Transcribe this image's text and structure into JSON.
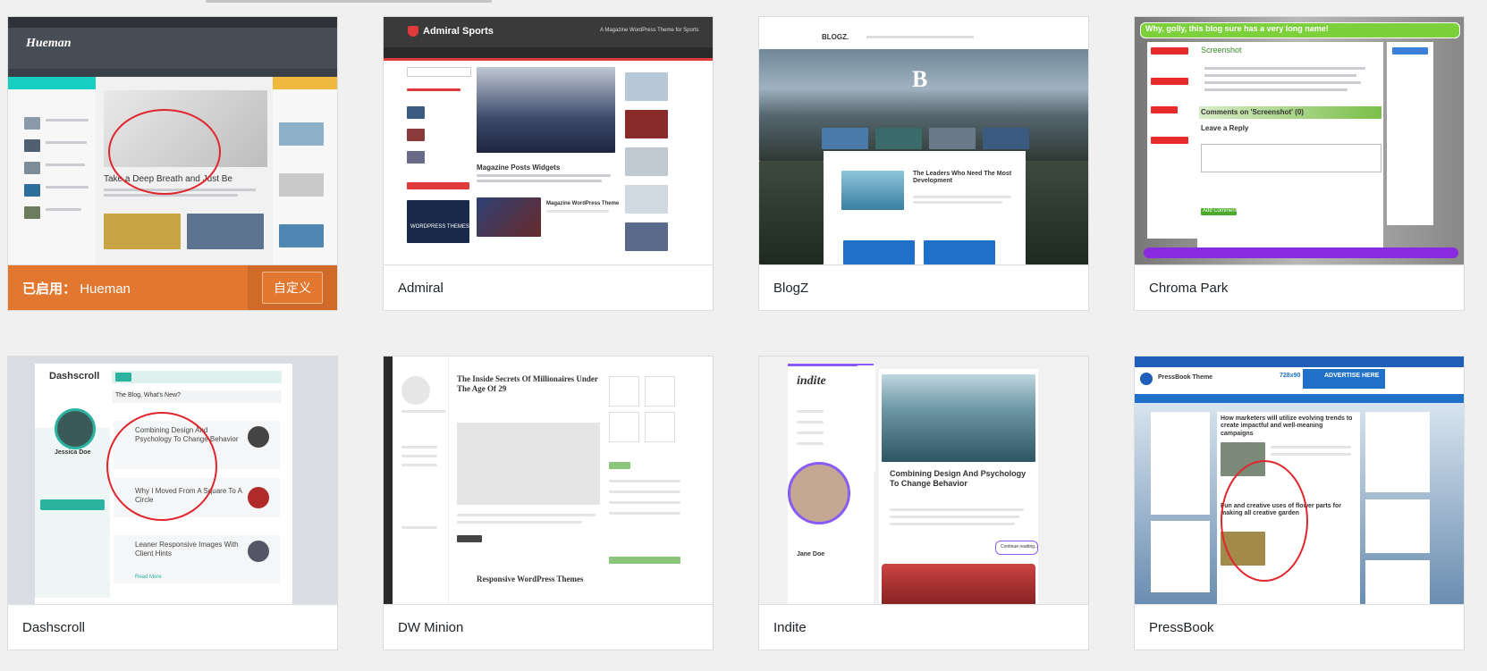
{
  "themes": [
    {
      "name": "Hueman",
      "active": true,
      "active_label": "已启用：",
      "customize_label": "自定义",
      "preview": {
        "logo": "Hueman",
        "post_title": "Take a Deep Breath and Just Be"
      }
    },
    {
      "name": "Admiral",
      "preview": {
        "site_title": "Admiral Sports",
        "tagline": "A Magazine WordPress Theme for Sports",
        "post_title": "Magazine Posts Widgets",
        "post_title_2": "Magazine WordPress Theme",
        "ad_text": "WORDPRESS THEMES"
      }
    },
    {
      "name": "BlogZ",
      "preview": {
        "logo": "BLOGZ.",
        "hero_letter": "B",
        "post_title": "The Leaders Who Need The Most Development"
      }
    },
    {
      "name": "Chroma Park",
      "preview": {
        "banner": "Why, golly, this blog sure has a very long name!",
        "post_heading": "Screenshot",
        "comments_heading": "Comments on 'Screenshot' (0)",
        "reply_heading": "Leave a Reply",
        "submit_label": "Add Comment"
      }
    },
    {
      "name": "Dashscroll",
      "preview": {
        "logo": "Dashscroll",
        "author": "Jessica Doe",
        "section": "The Blog, What's New?",
        "post_1": "Combining Design And Psychology To Change Behavior",
        "post_2": "Why I Moved From A Square To A Circle",
        "post_3": "Leaner Responsive Images With Client Hints",
        "read_more": "Read More"
      }
    },
    {
      "name": "DW Minion",
      "preview": {
        "post_title": "The Inside Secrets Of Millionaires Under The Age Of 29",
        "footer_title": "Responsive WordPress Themes"
      }
    },
    {
      "name": "Indite",
      "preview": {
        "logo": "indite",
        "post_title": "Combining Design And Psychology To Change Behavior",
        "author": "Jane Doe",
        "continue_label": "Continue reading..."
      }
    },
    {
      "name": "PressBook",
      "preview": {
        "site_title": "PressBook Theme",
        "ad_label": "ADVERTISE HERE",
        "ad_size": "728x90",
        "post_1": "How marketers will utilize evolving trends to create impactful and well-meaning campaigns",
        "post_2": "Fun and creative uses of flower parts for making all creative garden"
      }
    }
  ]
}
